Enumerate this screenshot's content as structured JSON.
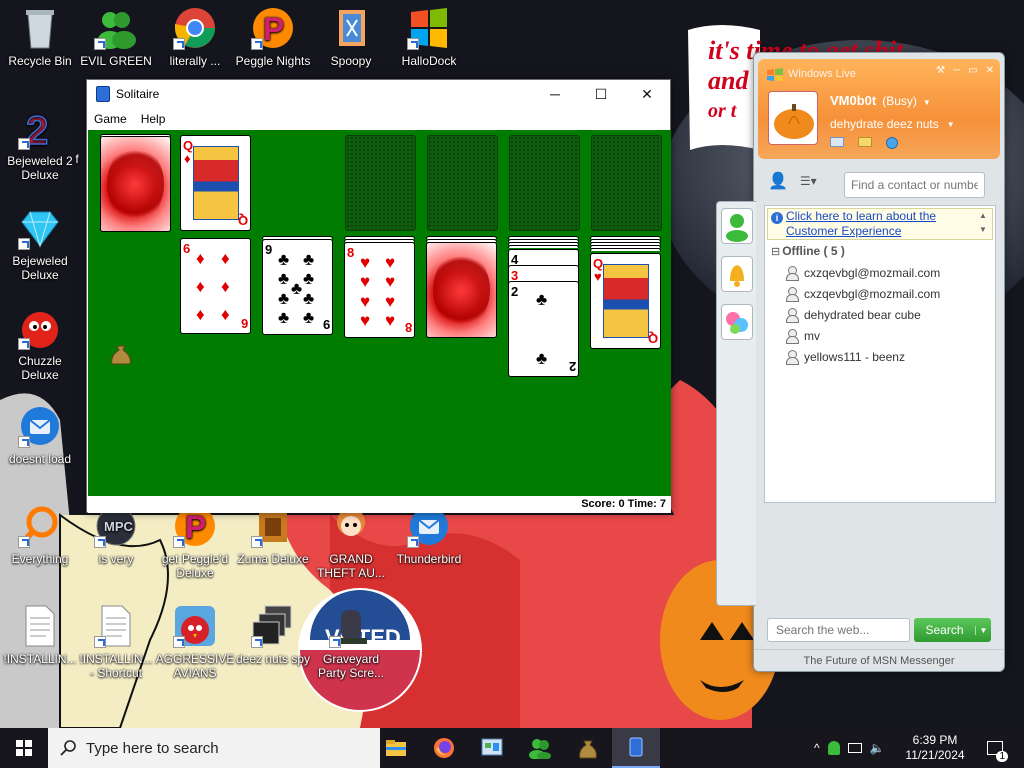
{
  "desktop": {
    "icons": [
      {
        "label": "Recycle Bin",
        "icon": "recycle-bin-icon"
      },
      {
        "label": "EVIL GREEN MSN CO...",
        "icon": "msn-green-people-icon"
      },
      {
        "label": "literally ...",
        "icon": "chrome-icon"
      },
      {
        "label": "Peggle Nights Del...",
        "icon": "peggle-icon"
      },
      {
        "label": "Spoopy",
        "icon": "spoopy-icon"
      },
      {
        "label": "HalloDock",
        "icon": "windows-logo-icon"
      },
      {
        "label": "Bejeweled 2 Deluxe",
        "icon": "bejeweled-2-icon"
      },
      {
        "label": "f",
        "icon": "partial-icon"
      },
      {
        "label": "Bejeweled Deluxe",
        "icon": "diamond-icon"
      },
      {
        "label": "Chuzzle Deluxe",
        "icon": "chuzzle-icon"
      },
      {
        "label": "doesnt load",
        "icon": "thunderbird-icon"
      },
      {
        "label": "Everything",
        "icon": "everything-search-icon"
      },
      {
        "label": "is very",
        "icon": "mpc-icon"
      },
      {
        "label": "get Peggle'd Deluxe",
        "icon": "peggle-icon"
      },
      {
        "label": "Zuma Deluxe",
        "icon": "zuma-icon"
      },
      {
        "label": "GRAND THEFT AU...",
        "icon": "anime-girl-icon"
      },
      {
        "label": "Thunderbird",
        "icon": "thunderbird-icon"
      },
      {
        "label": "!INSTALLIN...",
        "icon": "document-icon"
      },
      {
        "label": "!INSTALLIN... - Shortcut",
        "icon": "document-icon"
      },
      {
        "label": "AGGRESSIVE AVIANS",
        "icon": "angry-bird-icon"
      },
      {
        "label": "deez nuts spy",
        "icon": "windows-stack-icon"
      },
      {
        "label": "Graveyard Party Scre...",
        "icon": "graveyard-icon"
      }
    ],
    "wallpaper_text": [
      "it's time to get shit",
      "and",
      "or t"
    ]
  },
  "solitaire": {
    "title": "Solitaire",
    "menu": [
      "Game",
      "Help"
    ],
    "window_buttons": [
      "─",
      "☐",
      "✕"
    ],
    "score_label": "Score: 0 Time: 7",
    "foundation_card": {
      "rank": "Q",
      "suit": "♦"
    },
    "tableau": [
      {
        "rank": "6",
        "suit": "♦",
        "color": "red"
      },
      {
        "rank": "9",
        "suit": "♣",
        "color": "black"
      },
      {
        "rank": "8",
        "suit": "♥",
        "color": "red"
      },
      {
        "rank": "",
        "suit": "",
        "color": "back"
      },
      {
        "rank": "2",
        "suit": "♣",
        "color": "black",
        "behind": [
          "4",
          "3"
        ]
      },
      {
        "rank": "Q",
        "suit": "♥",
        "color": "red"
      }
    ],
    "colors": {
      "felt": "#007d00",
      "card_red": "#e10000"
    }
  },
  "messenger": {
    "title": "Windows Live",
    "username": "VM0b0t",
    "status": "(Busy)",
    "personal_message": "dehydrate deez nuts",
    "search_contact_placeholder": "Find a contact or number",
    "info_link": "Click here to learn about the Customer Experience",
    "group_label": "Offline ( 5 )",
    "group_toggle": "⊟",
    "contacts": [
      "cxzqevbgl@mozmail.com",
      "cxzqevbgl@mozmail.com",
      "dehydrated bear cube",
      "mv",
      "yellows111 - beenz"
    ],
    "web_search_placeholder": "Search the web...",
    "search_button": "Search",
    "footer": "The Future of MSN Messenger",
    "accent": "#f6913a",
    "search_green": "#3ea53e"
  },
  "taskbar": {
    "search_placeholder": "Type here to search",
    "time": "6:39 PM",
    "date": "11/21/2024",
    "notification_count": "1",
    "pinned": [
      "file-explorer-icon",
      "firefox-icon",
      "control-panel-icon",
      "msn-messenger-icon",
      "money-bag-icon",
      "solitaire-icon"
    ]
  }
}
